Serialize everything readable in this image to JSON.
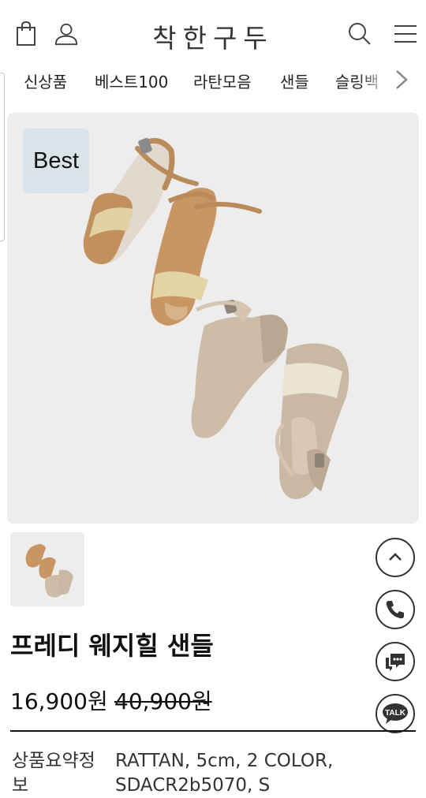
{
  "header": {
    "logo": "착한구두",
    "icons": [
      "shopping-bag-icon",
      "user-icon",
      "search-icon",
      "menu-icon"
    ]
  },
  "nav": {
    "items": [
      "신상품",
      "베스트100",
      "라탄모음",
      "샌들",
      "슬링백"
    ],
    "next_icon": "chevron-right-icon"
  },
  "hero": {
    "badge": "Best"
  },
  "side_buttons": [
    "chevron-up-icon",
    "phone-icon",
    "chat-icon",
    "kakao-talk-icon"
  ],
  "side": {
    "talk_label": "TALK"
  },
  "product": {
    "name": "프레디 웨지힐 샌들",
    "price": "16,900원",
    "original_price": "40,900원",
    "summary_label": "상품요약정보",
    "summary_value": "RATTAN, 5cm, 2 COLOR, SDACR2b5070, S"
  },
  "colors": {
    "text": "#222222",
    "badge_bg": "#d9e3e8",
    "hero_bg": "#ededee"
  }
}
